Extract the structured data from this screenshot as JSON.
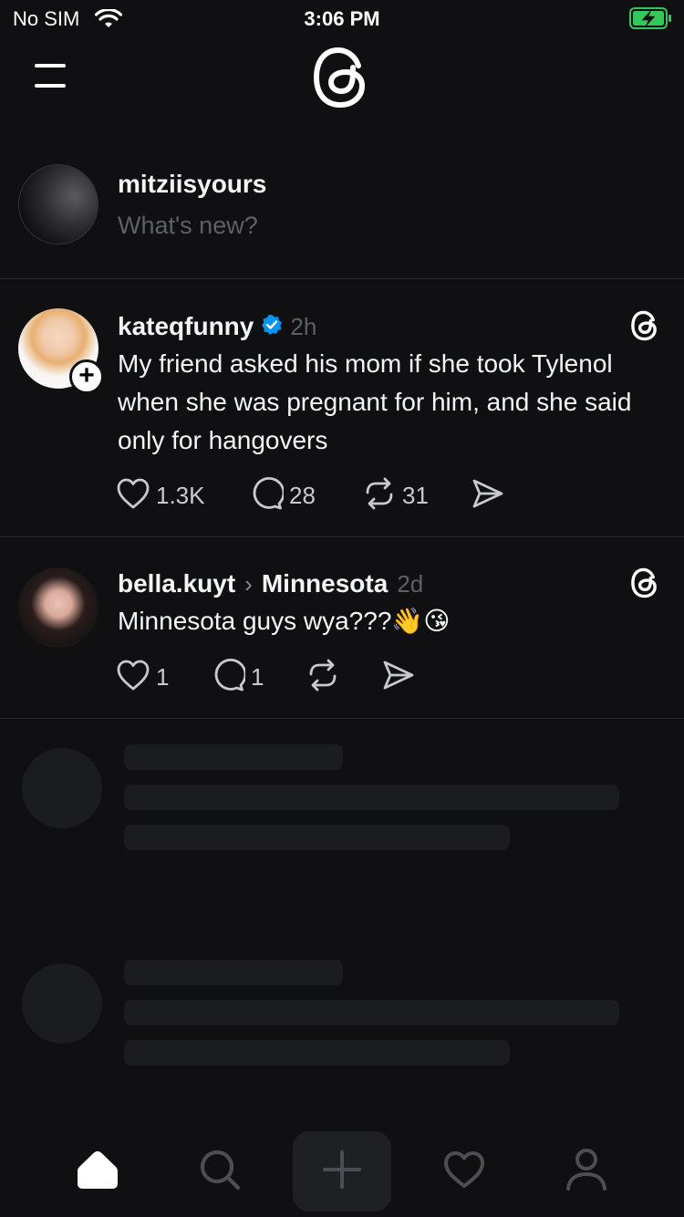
{
  "status_bar": {
    "carrier": "No SIM",
    "time": "3:06 PM",
    "battery_color": "#34c759"
  },
  "header": {
    "menu_icon": "menu-icon",
    "logo_icon": "threads-logo-icon"
  },
  "composer": {
    "username": "mitziisyours",
    "placeholder": "What's new?"
  },
  "posts": [
    {
      "username": "kateqfunny",
      "verified": true,
      "time": "2h",
      "text": "My friend asked his mom if she took Tylenol when she was pregnant for him, and she said only for hangovers",
      "likes": "1.3K",
      "replies": "28",
      "reposts": "31"
    },
    {
      "username": "bella.kuyt",
      "topic": "Minnesota",
      "time": "2d",
      "text": "Minnesota guys wya???👋😘",
      "likes": "1",
      "replies": "1"
    }
  ],
  "tab_bar": {
    "items": [
      "home-icon",
      "search-icon",
      "create-icon",
      "activity-icon",
      "profile-icon"
    ],
    "active": "home-icon"
  },
  "colors": {
    "background": "#101012",
    "text": "#f3f5f7",
    "muted": "#5f6065",
    "verified": "#0095f6",
    "skeleton": "#1b1c1f"
  }
}
